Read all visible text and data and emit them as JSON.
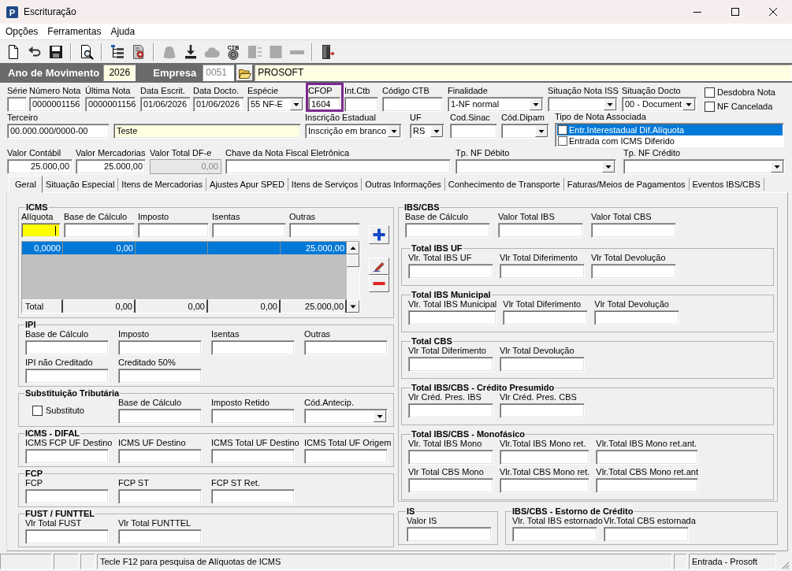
{
  "window": {
    "logo_text": "P",
    "title": "Escrituração"
  },
  "menu": [
    "Opções",
    "Ferramentas",
    "Ajuda"
  ],
  "toolbar": [
    [
      {
        "kind": "new",
        "disabled": false
      },
      {
        "kind": "undo",
        "disabled": false
      },
      {
        "kind": "save",
        "disabled": false
      }
    ],
    [
      {
        "kind": "preview",
        "disabled": false
      }
    ],
    [
      {
        "kind": "tree",
        "disabled": false
      },
      {
        "kind": "process",
        "disabled": false
      }
    ],
    [
      {
        "kind": "bag",
        "disabled": true
      },
      {
        "kind": "download",
        "disabled": false
      },
      {
        "kind": "cloud",
        "disabled": true
      },
      {
        "kind": "coin",
        "label": "CTB",
        "disabled": false
      },
      {
        "kind": "panel",
        "disabled": true
      },
      {
        "kind": "square",
        "disabled": true
      },
      {
        "kind": "bar",
        "disabled": true
      }
    ],
    [
      {
        "kind": "exit",
        "disabled": false
      }
    ]
  ],
  "header": {
    "year_label": "Ano de Movimento",
    "year": {
      "value": "2026",
      "highlighted": true
    },
    "company_label": "Empresa",
    "company_code": {
      "value": "0051",
      "disabled": true
    },
    "company_name": {
      "value": "PROSOFT",
      "highlighted": true
    }
  },
  "document": {
    "line_1": [
      {
        "label": "Série",
        "kind": "text",
        "disabled": false,
        "highlighted": false,
        "outlined": false
      },
      {
        "label": "Número Nota",
        "value": "0000001156",
        "kind": "text",
        "disabled": false,
        "highlighted": false,
        "outlined": false
      },
      {
        "label": "Última Nota",
        "value": "0000001156",
        "kind": "text",
        "disabled": false,
        "highlighted": false,
        "outlined": false
      },
      {
        "label": "Data Escrit.",
        "value": "01/06/2026",
        "kind": "text",
        "disabled": false,
        "highlighted": false,
        "outlined": false
      },
      {
        "label": "Data Docto.",
        "value": "01/06/2026",
        "kind": "text",
        "disabled": false,
        "highlighted": false,
        "outlined": false
      },
      {
        "label": "Espécie",
        "value": "55 NF-E",
        "kind": "combo",
        "disabled": false,
        "highlighted": false,
        "outlined": false
      },
      {
        "label": "CFOP",
        "value": "1604",
        "kind": "text",
        "disabled": false,
        "highlighted": false,
        "outlined": true
      },
      {
        "label": "Int.Ctb",
        "kind": "text",
        "disabled": false,
        "highlighted": false,
        "outlined": false
      },
      {
        "label": "Código CTB",
        "kind": "text",
        "disabled": false,
        "highlighted": false,
        "outlined": false
      },
      {
        "label": "Finalidade",
        "value": "1-NF normal",
        "kind": "combo",
        "disabled": false,
        "highlighted": false,
        "outlined": false
      },
      {
        "label": "Situação Nota ISS",
        "kind": "combo",
        "disabled": false,
        "highlighted": false,
        "outlined": false
      },
      {
        "label": "Situação Docto",
        "value": "00 - Document",
        "kind": "combo",
        "disabled": false,
        "highlighted": false,
        "outlined": false
      },
      {
        "kind": "checks",
        "options": [
          {
            "label": "Desdobra Nota",
            "checked": false
          },
          {
            "label": "NF Cancelada",
            "checked": false
          }
        ]
      }
    ],
    "line_2": [
      {
        "label": "Terceiro",
        "value": "00.000.000/0000-00",
        "kind": "text",
        "disabled": false,
        "highlighted": false,
        "outlined": false
      },
      {
        "value": "Teste",
        "kind": "text",
        "disabled": false,
        "highlighted": true,
        "outlined": false
      },
      {
        "label": "Inscrição Estadual",
        "value": "Inscrição em branco",
        "kind": "combo",
        "disabled": false,
        "highlighted": false,
        "outlined": false
      },
      {
        "label": "UF",
        "value": "RS",
        "kind": "combo",
        "disabled": false,
        "highlighted": false,
        "outlined": false
      },
      {
        "label": "Cod.Sinac",
        "kind": "text",
        "disabled": false,
        "highlighted": false,
        "outlined": false
      },
      {
        "label": "Cód.Dipam",
        "kind": "combo",
        "disabled": false,
        "highlighted": false,
        "outlined": false
      },
      {
        "label": "Tipo de Nota Associada",
        "kind": "checklist",
        "options": [
          {
            "label": "Entr.Interestadual Dif.Alíquota",
            "checked": false,
            "selected": true
          },
          {
            "label": "Entrada com ICMS Diferido",
            "checked": false,
            "selected": false
          }
        ]
      }
    ],
    "line_3": [
      {
        "label": "Valor Contábil",
        "value": "25.000,00",
        "kind": "number",
        "disabled": false,
        "highlighted": false,
        "outlined": false
      },
      {
        "label": "Valor Mercadorias",
        "value": "25.000,00",
        "kind": "number",
        "disabled": false,
        "highlighted": false,
        "outlined": false
      },
      {
        "label": "Valor Total DF-e",
        "value": "0,00",
        "kind": "number",
        "disabled": true,
        "highlighted": false,
        "outlined": false
      },
      {
        "label": "Chave da Nota Fiscal Eletrônica",
        "kind": "text",
        "disabled": false,
        "highlighted": false,
        "outlined": false
      },
      {
        "label": "Tp. NF Débito",
        "kind": "combo",
        "disabled": false,
        "highlighted": false,
        "outlined": false
      },
      {
        "label": "Tp. NF Crédito",
        "kind": "combo",
        "disabled": false,
        "highlighted": false,
        "outlined": false
      }
    ]
  },
  "tabs": [
    {
      "label": "Geral",
      "selected": true
    },
    {
      "label": "Situação Especial",
      "selected": false
    },
    {
      "label": "Itens de Mercadorias",
      "selected": false
    },
    {
      "label": "Ajustes Apur SPED",
      "selected": false
    },
    {
      "label": "Itens de Serviços",
      "selected": false
    },
    {
      "label": "Outras Informações",
      "selected": false
    },
    {
      "label": "Conhecimento de Transporte",
      "selected": false
    },
    {
      "label": "Faturas/Meios de Pagamentos",
      "selected": false
    },
    {
      "label": "Eventos IBS/CBS",
      "selected": false
    }
  ],
  "geral_tab": {
    "icms": {
      "title": "ICMS",
      "fields": [
        {
          "label": "Alíquota",
          "focused": true
        },
        {
          "label": "Base de Cálculo",
          "focused": false
        },
        {
          "label": "Imposto",
          "focused": false
        },
        {
          "label": "Isentas",
          "focused": false
        },
        {
          "label": "Outras",
          "focused": false
        }
      ],
      "grid": {
        "rows": [
          {
            "selected": true,
            "aliquota": "0,0000",
            "base": "0,00",
            "outras": "25.000,00"
          }
        ],
        "total": {
          "label": "Total",
          "base": "0,00",
          "imposto": "0,00",
          "isentas": "0,00",
          "outras": "25.000,00"
        }
      }
    },
    "groups": [
      {
        "title": "IPI",
        "rows": [
          [
            {
              "label": "Base de Cálculo",
              "kind": "text"
            },
            {
              "label": "Imposto",
              "kind": "text"
            },
            {
              "label": "Isentas",
              "kind": "text"
            },
            {
              "label": "Outras",
              "kind": "text"
            }
          ],
          [
            {
              "label": "IPI não Creditado",
              "kind": "text"
            },
            {
              "label": "Creditado 50%",
              "kind": "text"
            }
          ]
        ]
      },
      {
        "title": "Substituição Tributária",
        "rows": [
          [
            {
              "label": "Substituto",
              "kind": "check",
              "checked": false
            },
            {
              "label": "Base de Cálculo",
              "kind": "text"
            },
            {
              "label": "Imposto Retido",
              "kind": "text"
            },
            {
              "label": "Cód.Antecip.",
              "kind": "combo"
            }
          ]
        ]
      },
      {
        "title": "ICMS - DIFAL",
        "rows": [
          [
            {
              "label": "ICMS FCP UF Destino",
              "kind": "text"
            },
            {
              "label": "ICMS UF Destino",
              "kind": "text"
            },
            {
              "label": "ICMS Total UF Destino",
              "kind": "text"
            },
            {
              "label": "ICMS Total UF Origem",
              "kind": "text"
            }
          ]
        ]
      },
      {
        "title": "FCP",
        "rows": [
          [
            {
              "label": "FCP",
              "kind": "text"
            },
            {
              "label": "FCP ST",
              "kind": "text"
            },
            {
              "label": "FCP ST Ret.",
              "kind": "text"
            }
          ]
        ]
      },
      {
        "title": "FUST / FUNTTEL",
        "rows": [
          [
            {
              "label": "Vlr Total FUST",
              "kind": "text"
            },
            {
              "label": "Vlr Total FUNTTEL",
              "kind": "text"
            }
          ]
        ]
      }
    ],
    "ibs_cbs": {
      "title": "IBS/CBS",
      "fields": [
        {
          "label": "Base de Cálculo",
          "kind": "text"
        },
        {
          "label": "Valor Total IBS",
          "kind": "text"
        },
        {
          "label": "Valor Total CBS",
          "kind": "text"
        }
      ],
      "subgroups": [
        {
          "title": "Total IBS UF",
          "rows": [
            [
              {
                "label": "Vlr. Total IBS UF",
                "kind": "text"
              },
              {
                "label": "Vlr Total Diferimento",
                "kind": "text"
              },
              {
                "label": "Vlr Total Devolução",
                "kind": "text"
              }
            ]
          ]
        },
        {
          "title": "Total IBS Municipal",
          "rows": [
            [
              {
                "label": "Vlr. Total IBS Municipal",
                "kind": "text"
              },
              {
                "label": "Vlr Total Diferimento",
                "kind": "text"
              },
              {
                "label": "Vlr Total Devolução",
                "kind": "text"
              }
            ]
          ]
        },
        {
          "title": "Total CBS",
          "rows": [
            [
              {
                "label": "Vlr Total Diferimento",
                "kind": "text"
              },
              {
                "label": "Vlr Total Devolução",
                "kind": "text"
              }
            ]
          ]
        },
        {
          "title": "Total IBS/CBS - Crédito Presumido",
          "rows": [
            [
              {
                "label": "Vlr Créd. Pres. IBS",
                "kind": "text"
              },
              {
                "label": "Vlr Créd. Pres. CBS",
                "kind": "text"
              }
            ]
          ]
        },
        {
          "title": "Total IBS/CBS - Monofásico",
          "rows": [
            [
              {
                "label": "Vlr. Total IBS Mono",
                "kind": "text"
              },
              {
                "label": "Vlr.Total IBS Mono ret.",
                "kind": "text"
              },
              {
                "label": "Vlr.Total IBS Mono ret.ant.",
                "kind": "text"
              }
            ],
            [
              {
                "label": "Vlr Total CBS Mono",
                "kind": "text"
              },
              {
                "label": "Vlr.Total CBS Mono ret.",
                "kind": "text"
              },
              {
                "label": "Vlr.Total CBS Mono ret.ant",
                "kind": "text"
              }
            ]
          ]
        }
      ]
    },
    "bottom_groups": [
      {
        "title": "IS",
        "rows": [
          [
            {
              "label": "Valor IS",
              "kind": "text"
            }
          ]
        ]
      },
      {
        "title": "IBS/CBS - Estorno de Crédito",
        "rows": [
          [
            {
              "label": "Vlr. Total IBS estornado",
              "kind": "text"
            },
            {
              "label": "Vlr.Total CBS estornada",
              "kind": "text"
            }
          ]
        ]
      }
    ]
  },
  "status_bar": {
    "message": "Tecle F12 para pesquisa de Alíquotas de ICMS",
    "mode": "Entrada - Prosoft"
  }
}
